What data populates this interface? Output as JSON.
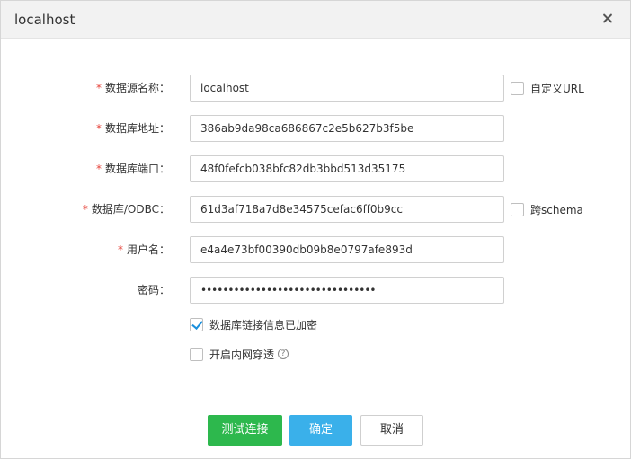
{
  "window": {
    "title": "localhost"
  },
  "form": {
    "fields": [
      {
        "label": "数据源名称：",
        "required": true,
        "value": "localhost"
      },
      {
        "label": "数据库地址：",
        "required": true,
        "value": "386ab9da98ca686867c2e5b627b3f5be"
      },
      {
        "label": "数据库端口：",
        "required": true,
        "value": "48f0fefcb038bfc82db3bbd513d35175"
      },
      {
        "label": "数据库/ODBC：",
        "required": true,
        "value": "61d3af718a7d8e34575cefac6ff0b9cc"
      },
      {
        "label": "用户名：",
        "required": true,
        "value": "e4a4e73bf00390db09b8e0797afe893d"
      },
      {
        "label": "密码：",
        "required": false,
        "value": "••••••••••••••••••••••••••••••••"
      }
    ],
    "required_mark": "*",
    "custom_url": {
      "label": "自定义URL",
      "checked": false
    },
    "cross_schema": {
      "label": "跨schema",
      "checked": false
    },
    "encrypt_info": {
      "label": "数据库链接信息已加密",
      "checked": true
    },
    "intranet": {
      "label": "开启内网穿透",
      "checked": false,
      "help": "?"
    }
  },
  "buttons": {
    "test": "测试连接",
    "ok": "确定",
    "cancel": "取消"
  },
  "colors": {
    "required": "#e6443b",
    "test": "#2db84d",
    "ok": "#3ab0ea",
    "check": "#1a8fdc"
  }
}
